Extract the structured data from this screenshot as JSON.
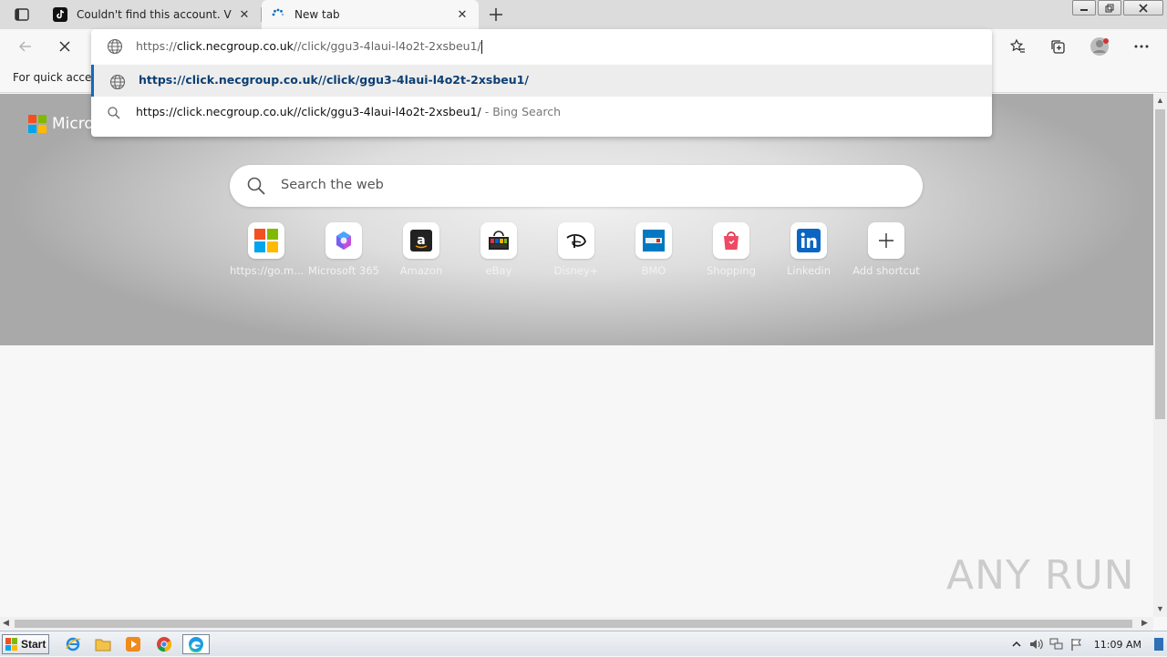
{
  "tabs": [
    {
      "title": "Couldn't find this account. Visit T",
      "icon": "tiktok-icon",
      "state": "inactive"
    },
    {
      "title": "New tab",
      "icon": "loading-spinner-icon",
      "state": "active"
    }
  ],
  "favorites_bar": {
    "text": "For quick access"
  },
  "omnibox": {
    "url_scheme": "https://",
    "url_host": "click.necgroup.co.uk",
    "url_path": "//click/ggu3-4laui-l4o2t-2xsbeu1/",
    "suggestions": [
      {
        "text": "https://click.necgroup.co.uk//click/ggu3-4laui-l4o2t-2xsbeu1/",
        "suffix": "",
        "icon": "globe-icon"
      },
      {
        "text": "https://click.necgroup.co.uk//click/ggu3-4laui-l4o2t-2xsbeu1/",
        "suffix": " - Bing Search",
        "icon": "search-icon"
      }
    ]
  },
  "newtab": {
    "brand": "Micro",
    "search_placeholder": "Search the web",
    "shortcuts": [
      {
        "label": "https://go.m...",
        "icon": "microsoft-icon"
      },
      {
        "label": "Microsoft 365",
        "icon": "m365-icon"
      },
      {
        "label": "Amazon",
        "icon": "amazon-icon"
      },
      {
        "label": "eBay",
        "icon": "ebay-icon"
      },
      {
        "label": "Disney+",
        "icon": "disney-icon"
      },
      {
        "label": "BMO",
        "icon": "bmo-icon"
      },
      {
        "label": "Shopping",
        "icon": "shopping-icon"
      },
      {
        "label": "Linkedin",
        "icon": "linkedin-icon"
      },
      {
        "label": "Add shortcut",
        "icon": "plus-icon"
      }
    ]
  },
  "watermark": "ANY RUN",
  "taskbar": {
    "start_label": "Start",
    "clock": "11:09 AM"
  },
  "colors": {
    "accent": "#0f6cbd",
    "suggestion_highlight": "#0b3f73",
    "ms_red": "#f25022",
    "ms_green": "#7fba00",
    "ms_blue": "#00a4ef",
    "ms_yellow": "#ffb900"
  }
}
